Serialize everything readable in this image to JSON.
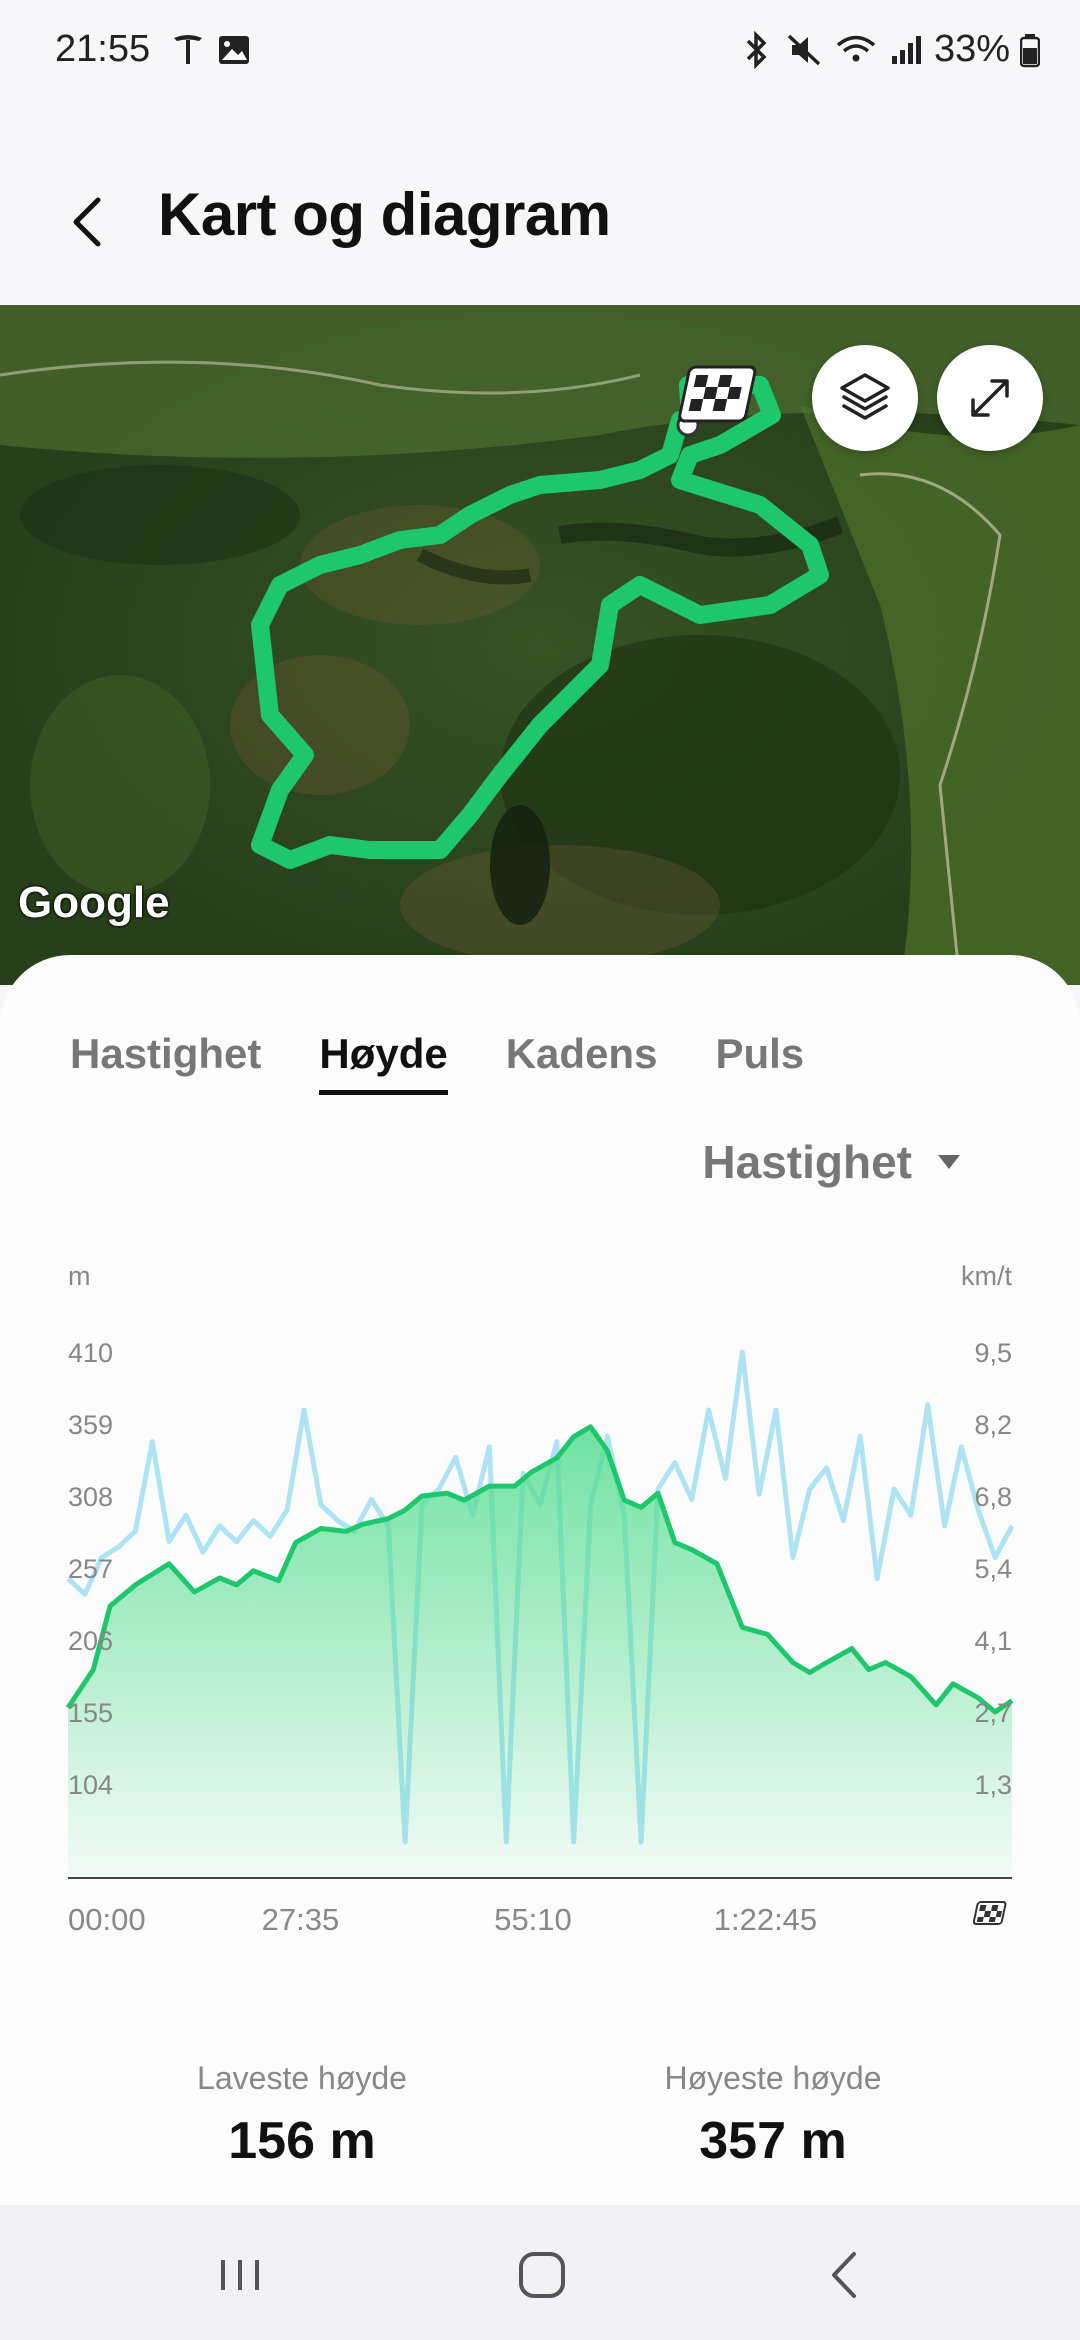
{
  "status": {
    "time": "21:55",
    "battery": "33%"
  },
  "header": {
    "title": "Kart og diagram"
  },
  "map": {
    "attribution": "Google"
  },
  "tabs": [
    {
      "label": "Hastighet",
      "active": false
    },
    {
      "label": "Høyde",
      "active": true
    },
    {
      "label": "Kadens",
      "active": false
    },
    {
      "label": "Puls",
      "active": false
    }
  ],
  "overlay_select": {
    "value": "Hastighet"
  },
  "chart_data": {
    "type": "area",
    "left_unit": "m",
    "right_unit": "km/t",
    "y_ticks_left": [
      "410",
      "359",
      "308",
      "257",
      "206",
      "155",
      "104"
    ],
    "y_ticks_right": [
      "9,5",
      "8,2",
      "6,8",
      "5,4",
      "4,1",
      "2,7",
      "1,3"
    ],
    "x_ticks": [
      "00:00",
      "27:35",
      "55:10",
      "1:22:45"
    ],
    "ylim_left": [
      104,
      410
    ],
    "series": [
      {
        "name": "Høyde",
        "color": "#1fc76c",
        "x_minutes": [
          0,
          3,
          5,
          8,
          12,
          15,
          18,
          20,
          22,
          25,
          27,
          30,
          33,
          35,
          38,
          40,
          42,
          45,
          47,
          50,
          53,
          55,
          58,
          60,
          62,
          64,
          66,
          68,
          70,
          72,
          74,
          77,
          80,
          83,
          86,
          88,
          90,
          93,
          95,
          97,
          100,
          103,
          105,
          108,
          110,
          112
        ],
        "values": [
          158,
          185,
          230,
          245,
          260,
          240,
          250,
          245,
          255,
          248,
          275,
          285,
          283,
          288,
          292,
          298,
          308,
          310,
          305,
          315,
          315,
          325,
          335,
          350,
          357,
          340,
          305,
          300,
          310,
          275,
          270,
          260,
          215,
          210,
          190,
          183,
          190,
          200,
          185,
          190,
          180,
          160,
          175,
          165,
          155,
          163
        ]
      },
      {
        "name": "Hastighet",
        "color": "#aee3f6",
        "x_minutes": [
          0,
          2,
          4,
          6,
          8,
          10,
          12,
          14,
          16,
          18,
          20,
          22,
          24,
          26,
          28,
          30,
          32,
          34,
          36,
          38,
          40,
          42,
          44,
          46,
          48,
          50,
          52,
          54,
          56,
          58,
          60,
          62,
          64,
          66,
          68,
          70,
          72,
          74,
          76,
          78,
          80,
          82,
          84,
          86,
          88,
          90,
          92,
          94,
          96,
          98,
          100,
          102,
          104,
          106,
          108,
          110,
          112
        ],
        "values": [
          5.2,
          4.9,
          5.6,
          5.8,
          6.1,
          7.8,
          5.9,
          6.4,
          5.7,
          6.2,
          5.9,
          6.3,
          6.0,
          6.5,
          8.4,
          6.6,
          6.3,
          6.1,
          6.7,
          6.2,
          0.2,
          6.6,
          6.9,
          7.5,
          6.4,
          7.7,
          0.2,
          7.2,
          6.6,
          7.8,
          0.2,
          6.6,
          7.9,
          6.4,
          0.2,
          6.9,
          7.4,
          6.7,
          8.4,
          7.1,
          9.5,
          6.8,
          8.4,
          5.6,
          6.9,
          7.3,
          6.3,
          7.9,
          5.2,
          6.9,
          6.4,
          8.5,
          6.2,
          7.7,
          6.5,
          5.6,
          6.2
        ]
      }
    ]
  },
  "stats": [
    {
      "label": "Laveste høyde",
      "value": "156 m"
    },
    {
      "label": "Høyeste høyde",
      "value": "357 m"
    }
  ]
}
